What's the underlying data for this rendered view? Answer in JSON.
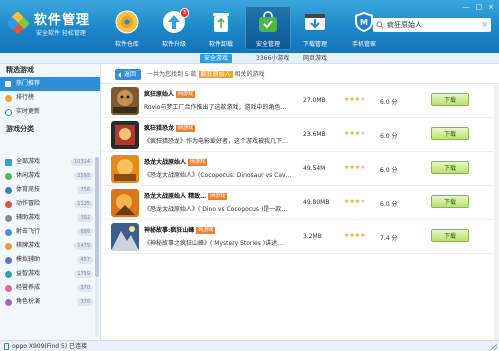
{
  "header": {
    "title": "软件管理",
    "slogan": "安全软件 轻松管理",
    "nav": [
      {
        "label": "软件仓库",
        "icon": "cd-icon",
        "color": "#f0b43a"
      },
      {
        "label": "软件升级",
        "icon": "upgrade-icon",
        "color": "#ffffff",
        "badge": "3"
      },
      {
        "label": "软件卸载",
        "icon": "recycle-bin-icon",
        "color": "#ffffff"
      },
      {
        "label": "安全管理",
        "icon": "security-bag-icon",
        "color": "#4cb648"
      },
      {
        "label": "下载管理",
        "icon": "download-icon",
        "color": "#333333"
      },
      {
        "label": "手机管家",
        "icon": "phone-manager-icon",
        "color": "#1a7fd0"
      }
    ],
    "search": {
      "value": "疯狂原始人"
    },
    "window_controls": [
      "—",
      "□",
      "×"
    ]
  },
  "subbar": {
    "safe_label": "安全游戏",
    "count_label": "3366小游戏",
    "web_label": "网页游戏"
  },
  "sidebar": {
    "section1": "精选游戏",
    "featured": [
      {
        "label": "热门推荐",
        "active": true
      },
      {
        "label": "排行榜"
      },
      {
        "label": "实时更新"
      }
    ],
    "section2": "游戏分类",
    "categories": [
      {
        "label": "全部游戏",
        "count": "10314"
      },
      {
        "label": "休闲游戏",
        "count": "2593"
      },
      {
        "label": "体育竞技",
        "count": "756"
      },
      {
        "label": "动作冒险",
        "count": "1125"
      },
      {
        "label": "辅助游戏",
        "count": "392"
      },
      {
        "label": "射击飞行",
        "count": "699"
      },
      {
        "label": "棋牌游戏",
        "count": "1479"
      },
      {
        "label": "模拟辅助",
        "count": "457"
      },
      {
        "label": "益智游戏",
        "count": "1759"
      },
      {
        "label": "经营养成",
        "count": "370"
      },
      {
        "label": "角色扮演",
        "count": "370"
      }
    ]
  },
  "results": {
    "back_label": "返回",
    "prefix": "一共为您找到 5 款",
    "keyword": "疯狂原始人",
    "suffix": "相关的游戏"
  },
  "apps": [
    {
      "name": "疯狂原始人",
      "tag": "网游戏",
      "desc": "Rovio与梦工厂合作推出了这款游戏，游戏中的角色…",
      "size": "27.0MB",
      "rating": 3,
      "score": "6.0 分",
      "button": "下载"
    },
    {
      "name": "疯狂猎恐龙",
      "tag": "网游戏",
      "desc": "《疯狂猎恐龙》作为电影爱好者，这个游戏被我几下…",
      "size": "23.6MB",
      "rating": 3,
      "score": "6.0 分",
      "button": "下载"
    },
    {
      "name": "恐龙大战原始人",
      "tag": "网游戏",
      "desc": "《恐龙大战原始人》(Cocopocus: Dinosaur vs Cav…",
      "size": "49.54M",
      "rating": 3,
      "score": "6.0 分",
      "button": "下载"
    },
    {
      "name": "恐龙大战原始人 精致…",
      "tag": "网游戏",
      "desc": "《恐龙大战原始人》( Dino vs Cocopocus )是一款…",
      "size": "49.80MB",
      "rating": 3,
      "score": "6.0 分",
      "button": "下载"
    },
    {
      "name": "神秘故事:疯狂山峰",
      "tag": "网游戏",
      "desc": "《神秘故事之疯狂山峰》( Mystery Stories )讲述…",
      "size": "3.2MB",
      "rating": 4,
      "score": "7.4 分",
      "button": "下载"
    }
  ],
  "status": {
    "text": "oppo X909(Find 5)  已连接"
  }
}
